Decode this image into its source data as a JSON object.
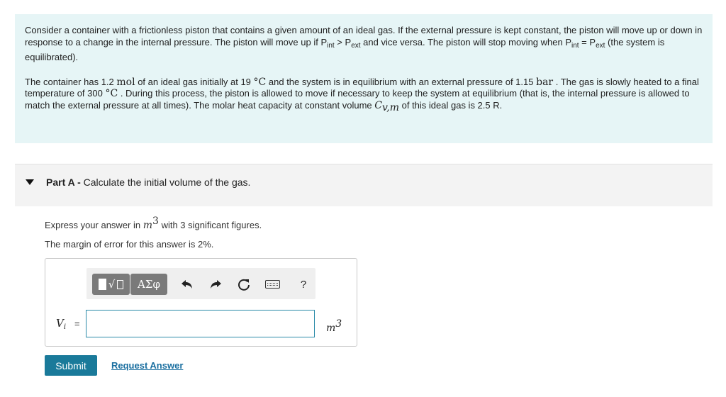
{
  "problem": {
    "p1_a": "Consider a container with a frictionless piston that contains a given amount of an ideal gas. If the external pressure is kept constant, the piston will move up or down in response to a change in the internal pressure. The piston will move up if P",
    "p1_int": "int",
    "p1_b": " > P",
    "p1_ext": "ext",
    "p1_c": " and vice versa. The piston will stop moving when P",
    "p1_int2": "int",
    "p1_d": " = P",
    "p1_ext2": "ext",
    "p1_e": " (the system is equilibrated).",
    "p2_a": "The container has ",
    "moles": "1.2",
    "moles_unit": "mol",
    "p2_b": " of an ideal gas initially at ",
    "temp_initial": "19",
    "temp_unit": "°C",
    "p2_c": " and the system is in equilibrium with an external pressure of ",
    "pressure": "1.15",
    "pressure_unit": "bar",
    "p2_d": ". The gas is slowly heated to a final temperature of ",
    "temp_final": "300",
    "temp_unit2": "°C",
    "p2_e": ". During this process, the piston is allowed to move if necessary to keep the system at equilibrium (that is, the internal pressure is allowed to match the external pressure at all times). The molar heat capacity at constant volume ",
    "cv_symbol": "C",
    "cv_sub": "v,m",
    "p2_f": " of this ideal gas is 2.5 R."
  },
  "part": {
    "label": "Part A -",
    "title": "Calculate the initial volume of the gas."
  },
  "instructions": {
    "line1_a": "Express your answer in ",
    "line1_unit": "m",
    "line1_exp": "3",
    "line1_b": " with 3 significant figures.",
    "line2": "The margin of error for this answer is 2%."
  },
  "toolbar": {
    "greek_label": "ΑΣφ",
    "help_label": "?"
  },
  "answer": {
    "variable": "V",
    "variable_sub": "i",
    "equals": "=",
    "value": "",
    "unit": "m",
    "unit_exp": "3"
  },
  "actions": {
    "submit_label": "Submit",
    "request_label": "Request Answer"
  },
  "colors": {
    "problem_bg": "#e6f5f6",
    "submit_bg": "#1a7a9a",
    "link": "#1a6fa0",
    "input_border": "#2a8aa8"
  }
}
